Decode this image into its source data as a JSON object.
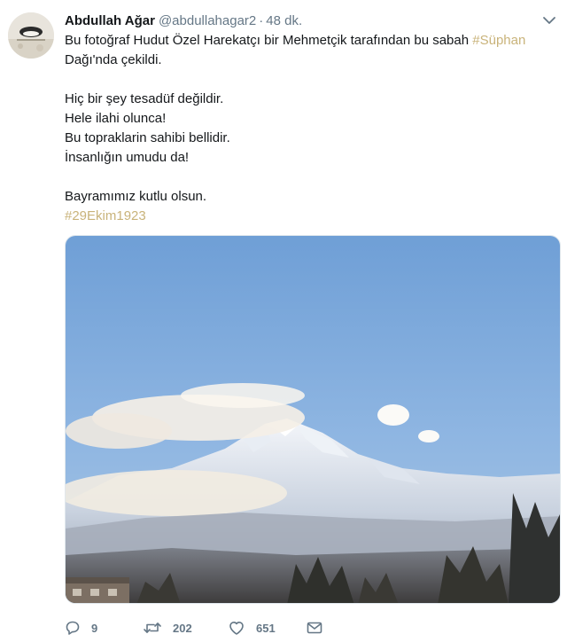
{
  "tweet": {
    "author_name": "Abdullah Ağar",
    "handle": "@abdullahagar2",
    "separator": "·",
    "time": "48 dk.",
    "text": {
      "line1_before": "Bu fotoğraf Hudut Özel Harekatçı bir Mehmetçik tarafından bu sabah ",
      "line1_hashtag": "#Süphan",
      "line2": "Dağı'nda çekildi.",
      "stanza": [
        "Hiç bir şey tesadüf değildir.",
        "Hele ilahi olunca!",
        "Bu topraklarin sahibi bellidir.",
        "İnsanlığın umudu da!"
      ],
      "closing": "Bayramımız kutlu olsun.",
      "closing_hashtag": "#29Ekim1923"
    },
    "colors": {
      "hashtag": "#c9b37a",
      "secondary_text": "#657786"
    },
    "actions": {
      "replies": "9",
      "retweets": "202",
      "likes": "651"
    },
    "icons": [
      "caret-down-icon",
      "reply-icon",
      "retweet-icon",
      "like-icon",
      "message-icon"
    ]
  }
}
